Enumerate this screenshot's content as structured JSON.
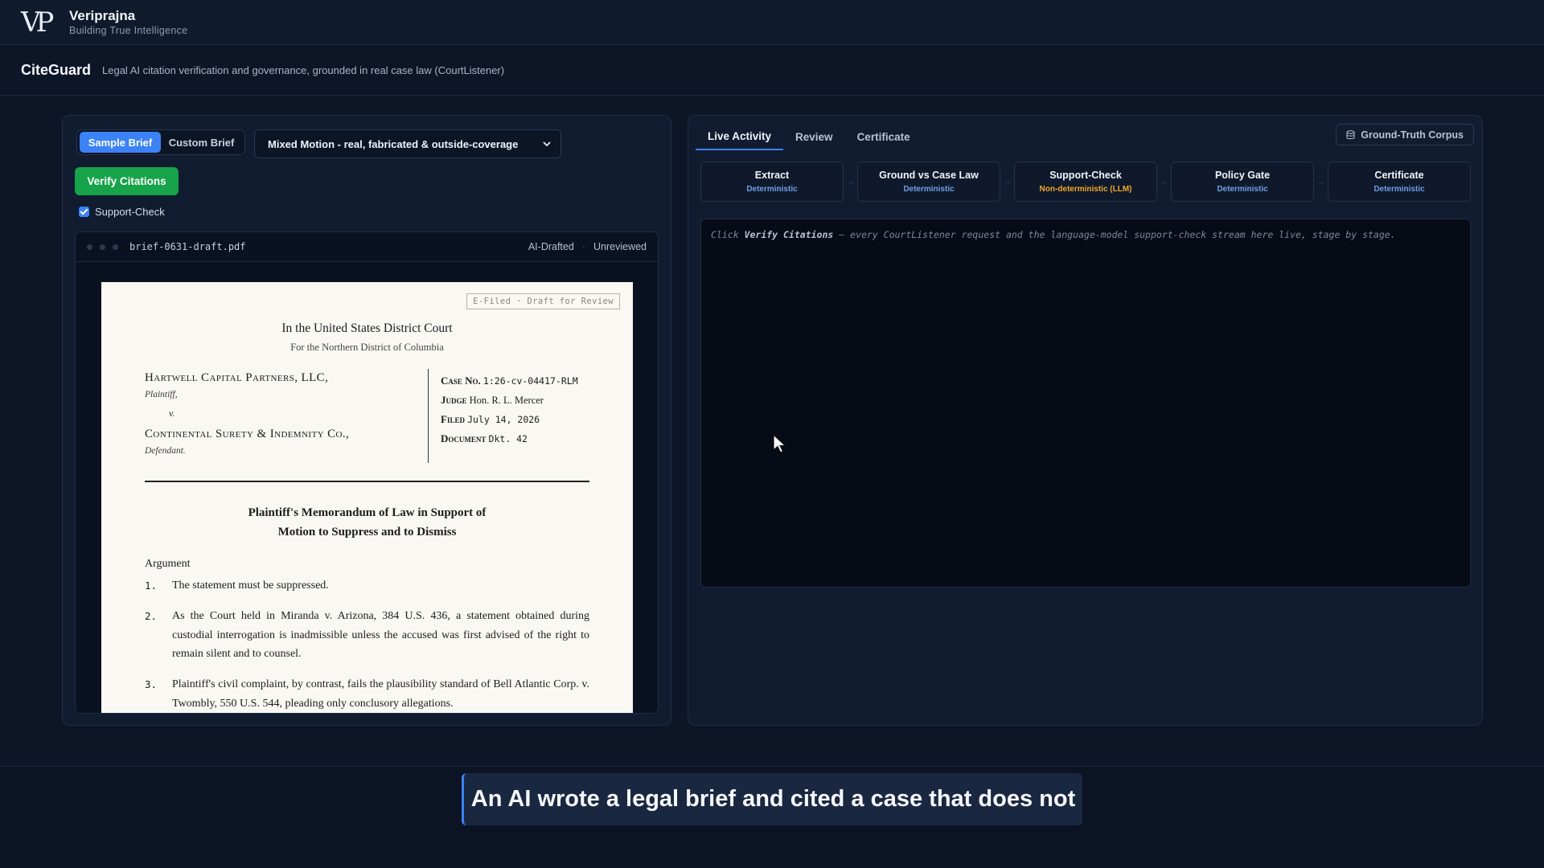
{
  "brand": {
    "name": "Veriprajna",
    "tagline": "Building True Intelligence",
    "logo_text": "VP"
  },
  "app": {
    "title": "CiteGuard",
    "subtitle": "Legal AI citation verification and governance, grounded in real case law (CourtListener)"
  },
  "left": {
    "mode_tabs": [
      "Sample Brief",
      "Custom Brief"
    ],
    "sample_select": "Mixed Motion - real, fabricated & outside-coverage",
    "verify_label": "Verify Citations",
    "support_check_label": "Support-Check",
    "support_check_checked": true,
    "viewer": {
      "filename": "brief-0631-draft.pdf",
      "status_a": "AI-Drafted",
      "status_b": "Unreviewed",
      "separator": "·"
    },
    "doc": {
      "stamp": "E-Filed · Draft for Review",
      "court": "In the United States District Court",
      "district": "For the Northern District of Columbia",
      "plaintiff": "Hartwell Capital Partners, LLC,",
      "plaintiff_role": "Plaintiff,",
      "versus": "v.",
      "defendant": "Continental Surety & Indemnity Co.,",
      "defendant_role": "Defendant.",
      "case_no_label": "Case No.",
      "case_no": "1:26-cv-04417-RLM",
      "judge_label": "Judge",
      "judge": "Hon. R. L. Mercer",
      "filed_label": "Filed",
      "filed": "July 14, 2026",
      "document_label": "Document",
      "document": "Dkt. 42",
      "memo_line1": "Plaintiff's Memorandum of Law in Support of",
      "memo_line2": "Motion to Suppress and to Dismiss",
      "section": "Argument",
      "paragraphs": [
        {
          "num": "1.",
          "text": "The statement must be suppressed."
        },
        {
          "num": "2.",
          "text": "As the Court held in Miranda v. Arizona, 384 U.S. 436, a statement obtained during custodial interrogation is inadmissible unless the accused was first advised of the right to remain silent and to counsel."
        },
        {
          "num": "3.",
          "text": "Plaintiff's civil complaint, by contrast, fails the plausibility standard of Bell Atlantic Corp. v. Twombly, 550 U.S. 544, pleading only conclusory allegations."
        }
      ]
    }
  },
  "right": {
    "tabs": [
      "Live Activity",
      "Review",
      "Certificate"
    ],
    "corpus_button": "Ground-Truth Corpus",
    "stages": [
      {
        "name": "Extract",
        "type": "Deterministic"
      },
      {
        "name": "Ground vs Case Law",
        "type": "Deterministic"
      },
      {
        "name": "Support-Check",
        "type": "Non-deterministic (LLM)"
      },
      {
        "name": "Policy Gate",
        "type": "Deterministic"
      },
      {
        "name": "Certificate",
        "type": "Deterministic"
      }
    ],
    "console": {
      "pre": "Click ",
      "bold": "Verify Citations",
      "post": " — every CourtListener request and the language-model support-check stream here live, stage by stage."
    }
  },
  "footer_caption": "An AI wrote a legal brief and cited a case that does not",
  "colors": {
    "accent": "#3b82f6",
    "success": "#16a34a",
    "llm": "#f0a928",
    "background": "#0d1627"
  }
}
